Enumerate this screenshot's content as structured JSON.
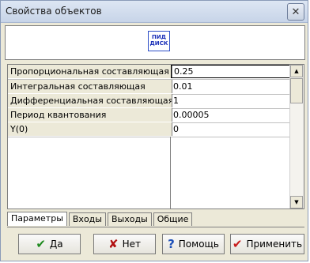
{
  "window": {
    "title": "Свойства объектов",
    "close_glyph": "✕"
  },
  "preview": {
    "block_label_line1": "ПИД",
    "block_label_line2": "ДИСК"
  },
  "properties": [
    {
      "name": "Пропорциональная составляющая",
      "value": "0.25"
    },
    {
      "name": "Интегральная составляющая",
      "value": "0.01"
    },
    {
      "name": "Дифференциальная составляющая",
      "value": "1"
    },
    {
      "name": "Период квантования",
      "value": "0.00005"
    },
    {
      "name": "Y(0)",
      "value": "0"
    }
  ],
  "tabs": [
    {
      "label": "Параметры"
    },
    {
      "label": "Входы"
    },
    {
      "label": "Выходы"
    },
    {
      "label": "Общие"
    }
  ],
  "buttons": {
    "ok": {
      "label": "Да",
      "icon": "✔"
    },
    "cancel": {
      "label": "Нет",
      "icon": "✘"
    },
    "help": {
      "label": "Помощь",
      "icon": "?"
    },
    "apply": {
      "label": "Применить",
      "icon": "✔"
    }
  },
  "colors": {
    "ok_icon": "#1f8a1f",
    "cancel_icon": "#b11010",
    "help_icon": "#1c4fb8",
    "apply_icon": "#c81b1b"
  }
}
